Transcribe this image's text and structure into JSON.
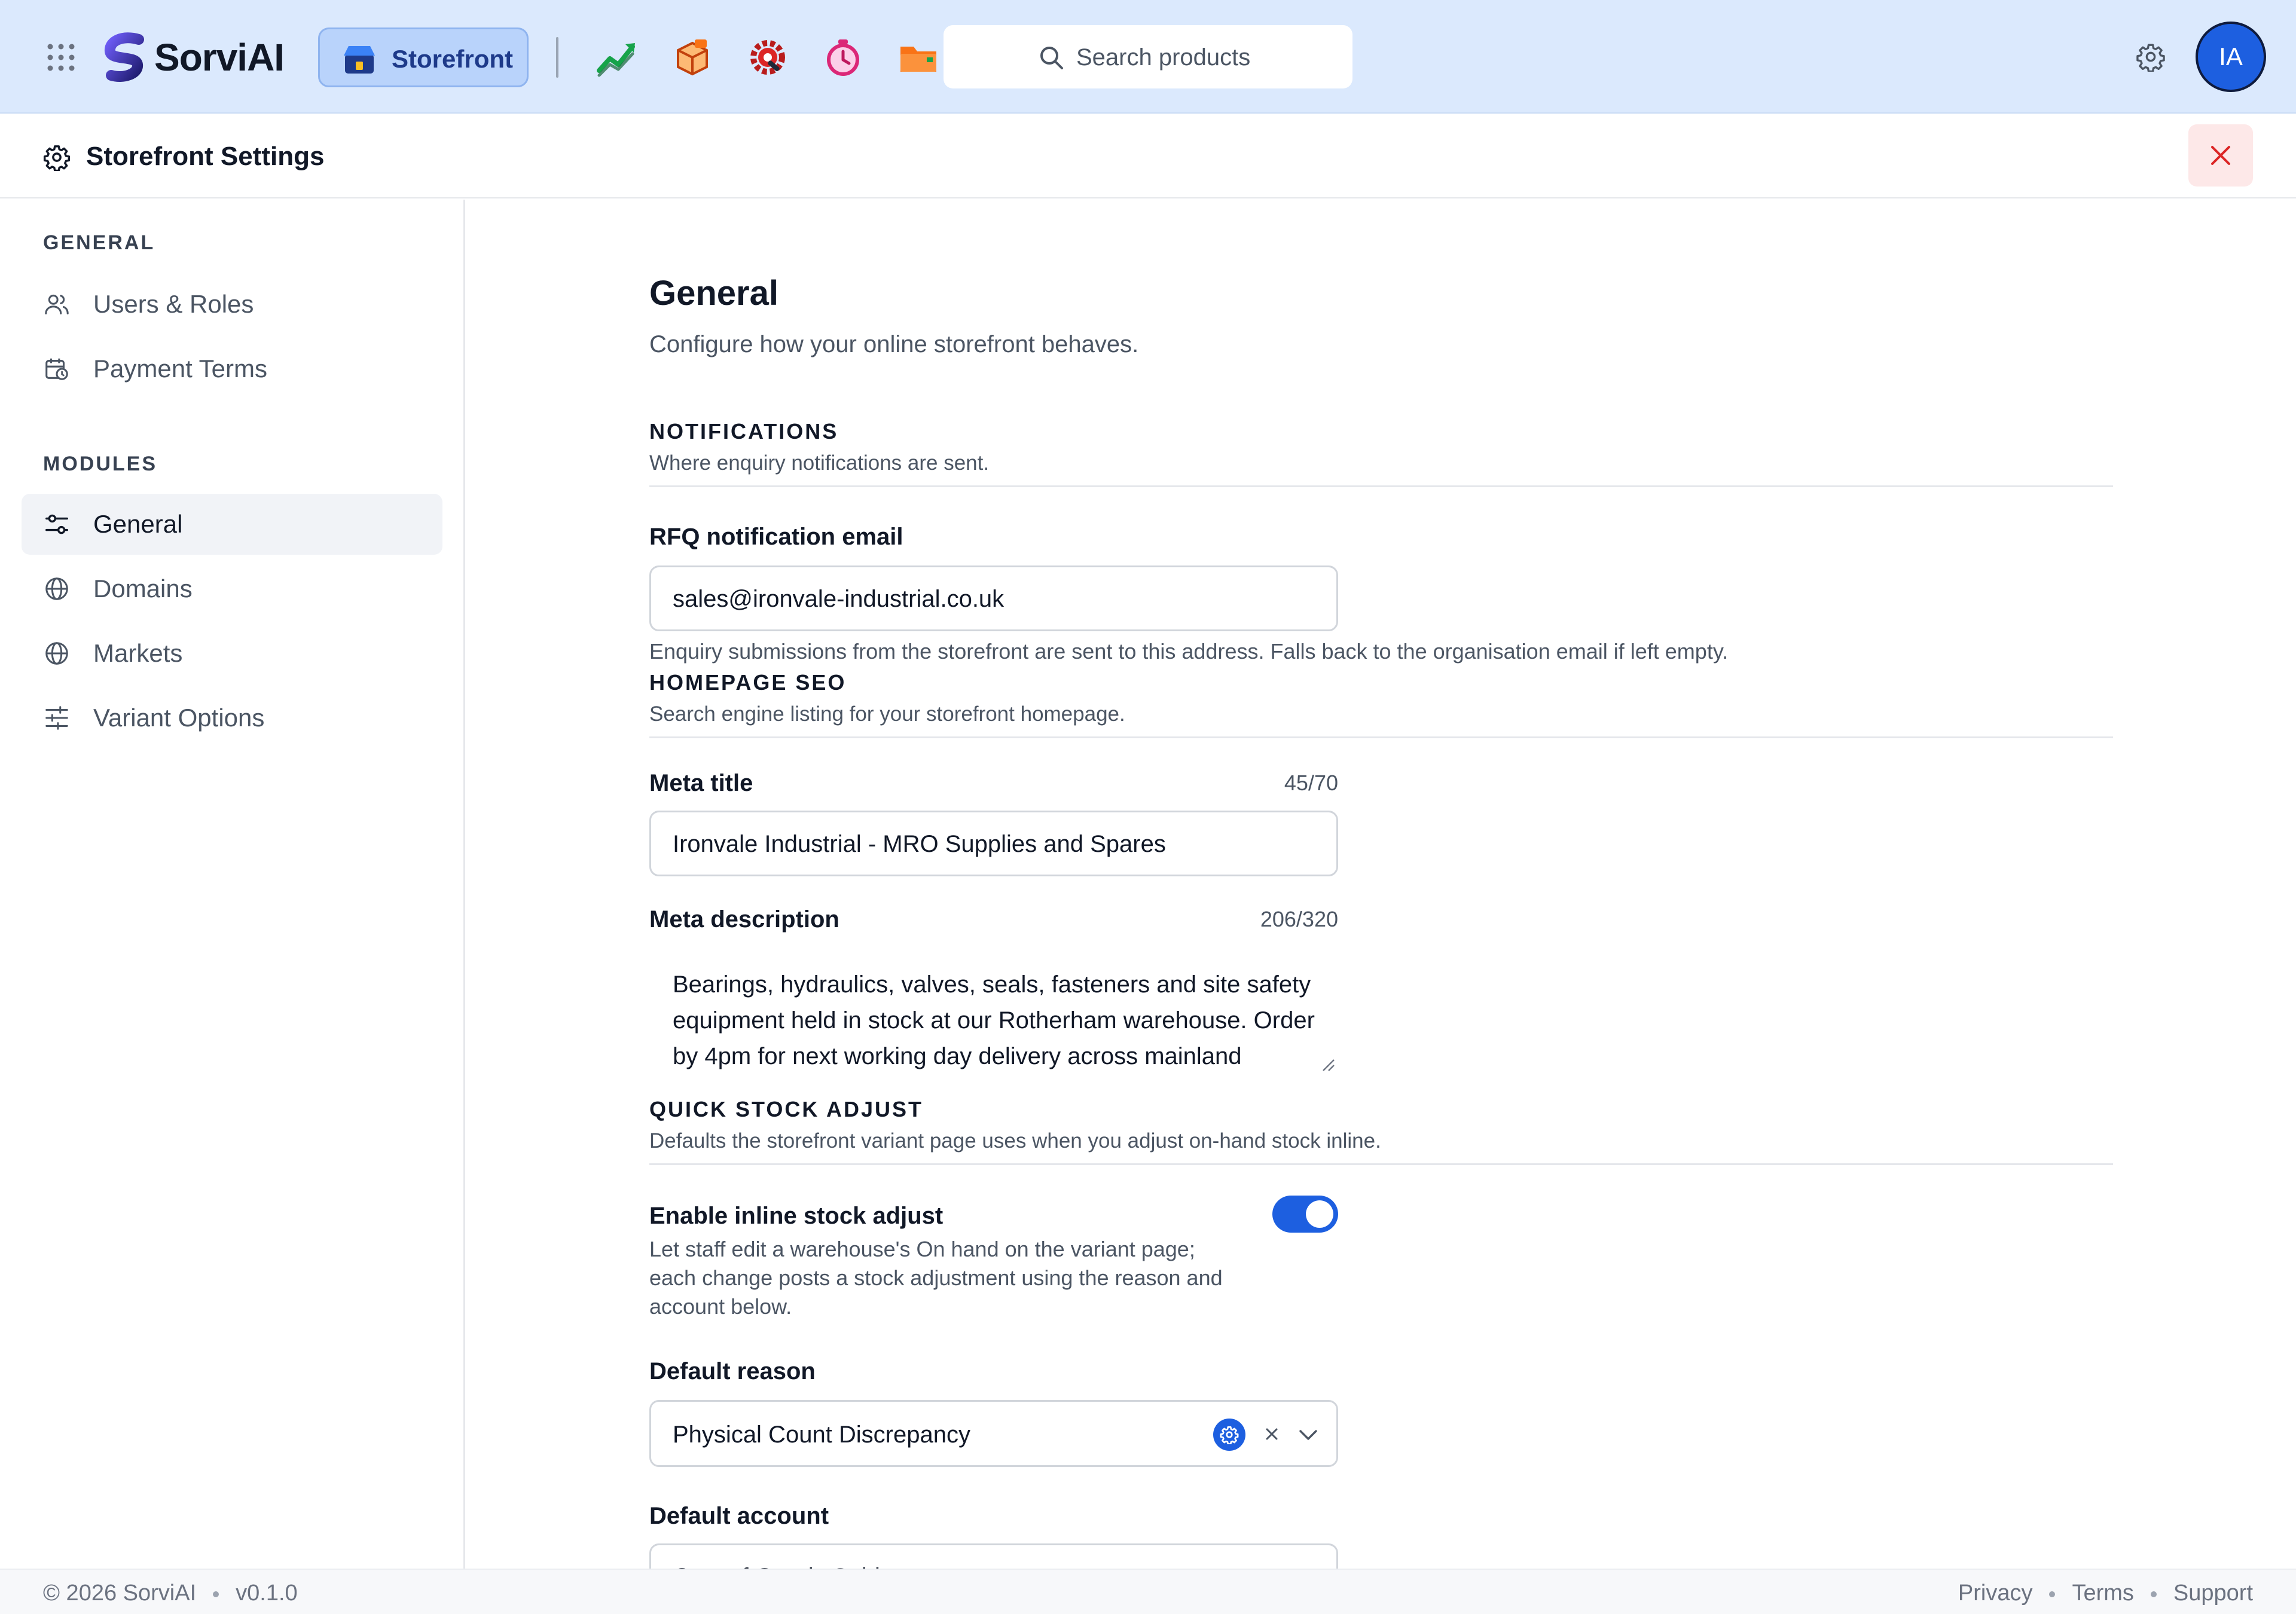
{
  "topbar": {
    "brand": "SorviAI",
    "active_app": "Storefront",
    "apps": [
      "sales-chart-icon",
      "inventory-box-icon",
      "service-gear-icon",
      "timer-icon",
      "folder-icon"
    ],
    "search_placeholder": "Search products",
    "avatar_initials": "IA"
  },
  "header": {
    "title": "Storefront Settings"
  },
  "sidebar": {
    "general_heading": "GENERAL",
    "general_items": [
      {
        "label": "Users & Roles",
        "icon": "users-icon"
      },
      {
        "label": "Payment Terms",
        "icon": "calendar-clock-icon"
      }
    ],
    "modules_heading": "MODULES",
    "module_items": [
      {
        "label": "General",
        "icon": "sliders-icon",
        "active": true
      },
      {
        "label": "Domains",
        "icon": "globe-icon"
      },
      {
        "label": "Markets",
        "icon": "globe-icon"
      },
      {
        "label": "Variant Options",
        "icon": "adjustments-icon"
      }
    ]
  },
  "main": {
    "title": "General",
    "subtitle": "Configure how your online storefront behaves.",
    "notifications": {
      "title": "NOTIFICATIONS",
      "description": "Where enquiry notifications are sent.",
      "rfq_label": "RFQ notification email",
      "rfq_value": "sales@ironvale-industrial.co.uk",
      "rfq_help": "Enquiry submissions from the storefront are sent to this address. Falls back to the organisation email if left empty."
    },
    "seo": {
      "title": "HOMEPAGE SEO",
      "description": "Search engine listing for your storefront homepage.",
      "meta_title_label": "Meta title",
      "meta_title_count": "45/70",
      "meta_title_value": "Ironvale Industrial - MRO Supplies and Spares",
      "meta_desc_label": "Meta description",
      "meta_desc_count": "206/320",
      "meta_desc_value": "Bearings, hydraulics, valves, seals, fasteners and site safety equipment held in stock at our Rotherham warehouse. Order by 4pm for next working day delivery across mainland Britain. Trade accounts welcome."
    },
    "stock": {
      "title": "QUICK STOCK ADJUST",
      "description": "Defaults the storefront variant page uses when you adjust on-hand stock inline.",
      "toggle_label": "Enable inline stock adjust",
      "toggle_on": true,
      "toggle_desc": "Let staff edit a warehouse's On hand on the variant page; each change posts a stock adjustment using the reason and account below.",
      "reason_label": "Default reason",
      "reason_value": "Physical Count Discrepancy",
      "account_label": "Default account",
      "account_value": "Cost of Goods Sold"
    }
  },
  "footer": {
    "copyright": "© 2026 SorviAI",
    "version": "v0.1.0",
    "links": [
      "Privacy",
      "Terms",
      "Support"
    ]
  },
  "colors": {
    "topbar_bg": "#dbe9fd",
    "accent": "#1d5fe0",
    "close_bg": "#fde8e8",
    "close_icon": "#dc2626"
  }
}
